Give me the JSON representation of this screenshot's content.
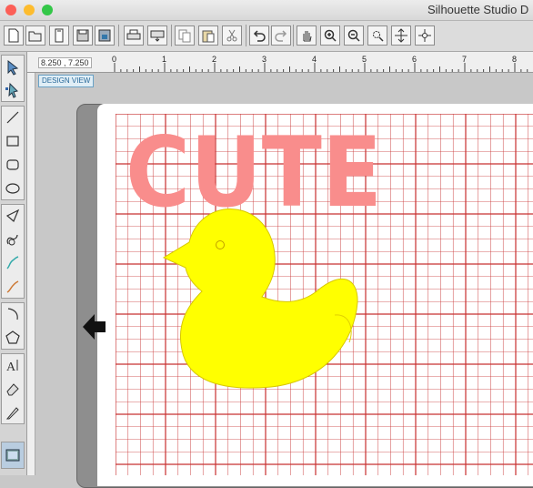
{
  "window": {
    "title": "Silhouette Studio D",
    "traffic_colors": [
      "#fc5f57",
      "#fdbc2e",
      "#33c748"
    ]
  },
  "toolbar": {
    "icons": [
      "new-document-icon",
      "open-folder-icon",
      "sd-card-icon",
      "save-icon",
      "save-to-library-icon",
      "print-icon",
      "send-to-silhouette-icon",
      "copy-icon",
      "paste-icon",
      "cut-icon",
      "undo-icon",
      "redo-icon",
      "pan-hand-icon",
      "zoom-in-icon",
      "zoom-out-icon",
      "zoom-select-icon",
      "fit-to-window-icon",
      "fit-page-icon"
    ]
  },
  "ruler": {
    "coordinates": "8.250 , 7.250",
    "marks": [
      "0",
      "1",
      "2",
      "3",
      "4",
      "5",
      "6",
      "7",
      "8"
    ]
  },
  "view_tab": "DESIGN VIEW",
  "canvas": {
    "text": "CUTE",
    "text_color": "#f98d8c",
    "chick_color": "#ffff00",
    "grid_color": "#cc3333",
    "mat_color": "#8e8e8e"
  },
  "left_tools": [
    "select-icon",
    "point-edit-icon",
    "line-icon",
    "rectangle-icon",
    "rounded-rectangle-icon",
    "ellipse-icon",
    "polygon-icon",
    "curve-icon",
    "freehand-icon",
    "smooth-freehand-icon",
    "arc-icon",
    "regular-polygon-icon",
    "text-icon",
    "eraser-icon",
    "knife-icon",
    "page-view-icon"
  ]
}
